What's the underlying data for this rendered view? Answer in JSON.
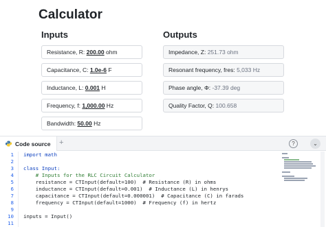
{
  "page": {
    "title": "Calculator"
  },
  "inputs": {
    "heading": "Inputs",
    "fields": [
      {
        "label": "Resistance, R: ",
        "value": "200.00",
        "unit": " ohm"
      },
      {
        "label": "Capacitance, C: ",
        "value": "1.0e-6",
        "unit": " F"
      },
      {
        "label": "Inductance, L: ",
        "value": "0.001",
        "unit": " H"
      },
      {
        "label": "Frequency, f: ",
        "value": "1,000.00",
        "unit": " Hz"
      },
      {
        "label": "Bandwidth: ",
        "value": "50.00",
        "unit": " Hz"
      }
    ]
  },
  "outputs": {
    "heading": "Outputs",
    "fields": [
      {
        "label": "Impedance, Z: ",
        "value": "251.73 ohm"
      },
      {
        "label": "Resonant frequency, fres: ",
        "value": "5,033 Hz"
      },
      {
        "label": "Phase angle, Φ: ",
        "value": "-37.39 deg"
      },
      {
        "label": "Quality Factor, Q: ",
        "value": "100.658"
      }
    ]
  },
  "code_panel": {
    "tab_label": "Code source",
    "add_tab": "+",
    "help_icon": "?",
    "collapse_icon": "⌄",
    "line_numbers": [
      "1",
      "2",
      "3",
      "4",
      "5",
      "6",
      "7",
      "8",
      "9",
      "10",
      "11"
    ],
    "lines": [
      "import math",
      "",
      "class Input:",
      "    # Inputs for the RLC Circuit Calculator",
      "    resistance = CTInput(default=100)  # Resistance (R) in ohms",
      "    inductance = CTInput(default=0.001)  # Inductance (L) in henrys",
      "    capacitance = CTInput(default=0.000001)  # Capacitance (C) in farads",
      "    frequency = CTInput(default=1000)  # Frequency (f) in hertz",
      "",
      "inputs = Input()",
      ""
    ]
  }
}
